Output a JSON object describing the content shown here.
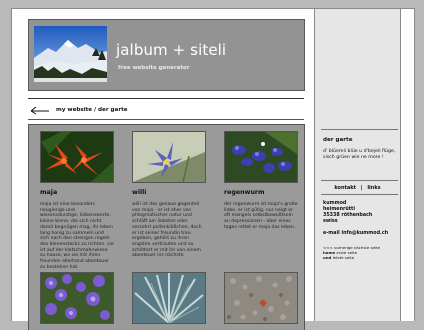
{
  "header": {
    "title": "jalbum + siteli",
    "subtitle": "free website generator"
  },
  "breadcrumb": {
    "text": "my website / der garte"
  },
  "gallery": {
    "items": [
      {
        "caption": "maja",
        "description": "maja ist eine besonders neugierige und wissensdurstige, liebenswerte, kleine biene, die sich nicht damit begnügen mag, ihr leben lang honig zu sammeln und sich nach den strengen regeln des bienenstocks zu richten. sie ist auf der klatschmohnwiese zu hause, wo sie mit ihren freunden allerhand abenteuer zu bestehen hat."
      },
      {
        "caption": "willi",
        "description": "willi ist das genaue gegenteil von maja - er ist eher von phlegmatischer natur und schläft am liebsten oder verzehrt pollenklößchen, doch er ist seiner freundin treu ergeben, gehört zu ihren engsten vertrauten und so schlittert er mit ihr von einem abenteuer ins nächste"
      },
      {
        "caption": "regenwurm",
        "description": "der regenwurm ist maja's große liebe. er ist gütig, nur neigt er oft mangels selbstbewußtsein an depressionen - aber eines tages rettet er maja das leben."
      },
      {
        "caption": "",
        "description": ""
      },
      {
        "caption": "",
        "description": ""
      },
      {
        "caption": "",
        "description": ""
      }
    ]
  },
  "sidebar": {
    "title": "der garte",
    "text": "d' blüemli blüe u d'bejeli flüge, sisch grüen wie ne more !",
    "links": {
      "kontakt": "kontakt",
      "separator": "|",
      "links": "links"
    },
    "address": [
      "kummod",
      "heimenrütti",
      "35338 röthenbach",
      "swiss"
    ],
    "email_label": "e-mail",
    "email": "info@kummod.ch",
    "nav": [
      {
        "prefix": "<<<",
        "label": "vorherige",
        "suffix": "nächste seite"
      },
      {
        "prefix": "",
        "label": "home",
        "suffix": "erste seite"
      },
      {
        "prefix": "",
        "label": "und",
        "suffix": "letzte seite"
      }
    ]
  },
  "colors": {
    "page_bg": "#b9b9b9",
    "header_bg": "#939393",
    "gallery_bg": "#9a9a9a",
    "sidebar_bg": "#e6e6e6"
  }
}
